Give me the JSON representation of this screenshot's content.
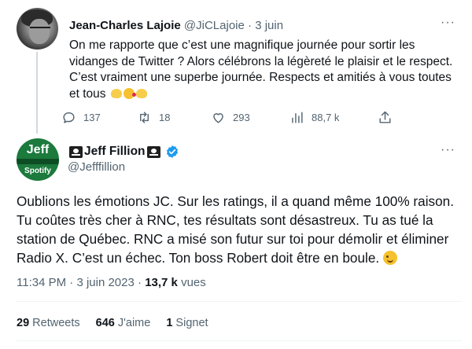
{
  "reply": {
    "name": "Jean-Charles Lajoie",
    "handle": "@JiCLajoie",
    "separator": "·",
    "date": "3 juin",
    "more": "···",
    "text": "On me rapporte que c’est une magnifique journée pour sortir les vidanges de Twitter ? Alors célébrons la légèreté le plaisir et le respect. C’est vraiment une superbe journée. Respects et amitiés à vous toutes et tous",
    "emojis": [
      "heart-hands",
      "face-blowing-kiss",
      "heart-hands"
    ],
    "actions": {
      "replies": "137",
      "retweets": "18",
      "likes": "293",
      "views": "88,7 k"
    }
  },
  "tweet": {
    "name": "Jeff Fillion",
    "handle": "@Jefffillion",
    "more": "···",
    "avatar": {
      "top_text": "Jeff",
      "bottom_text": "Spotify"
    },
    "text": "Oublions les émotions JC. Sur les ratings, il a quand même 100% raison. Tu coûtes très cher à RNC, tes résultats sont désastreux. Tu as tué la station de Québec. RNC a misé son futur sur toi pour démolir et éliminer Radio X. C’est un échec. Ton boss Robert doit être en boule.",
    "text_emoji": "winking-face",
    "meta": {
      "time": "11:34 PM",
      "separator": "·",
      "date": "3 juin 2023",
      "separator2": "·",
      "views_count": "13,7 k",
      "views_label": "vues"
    },
    "stats": {
      "retweets_count": "29",
      "retweets_label": "Retweets",
      "likes_count": "646",
      "likes_label": "J'aime",
      "bookmarks_count": "1",
      "bookmarks_label": "Signet"
    }
  },
  "colors": {
    "text_primary": "#0f1419",
    "text_secondary": "#536471",
    "verified_blue": "#1d9bf0",
    "divider": "#eff3f4",
    "thread_line": "#cfd9de",
    "avatar_green": "#1b7a3c"
  }
}
